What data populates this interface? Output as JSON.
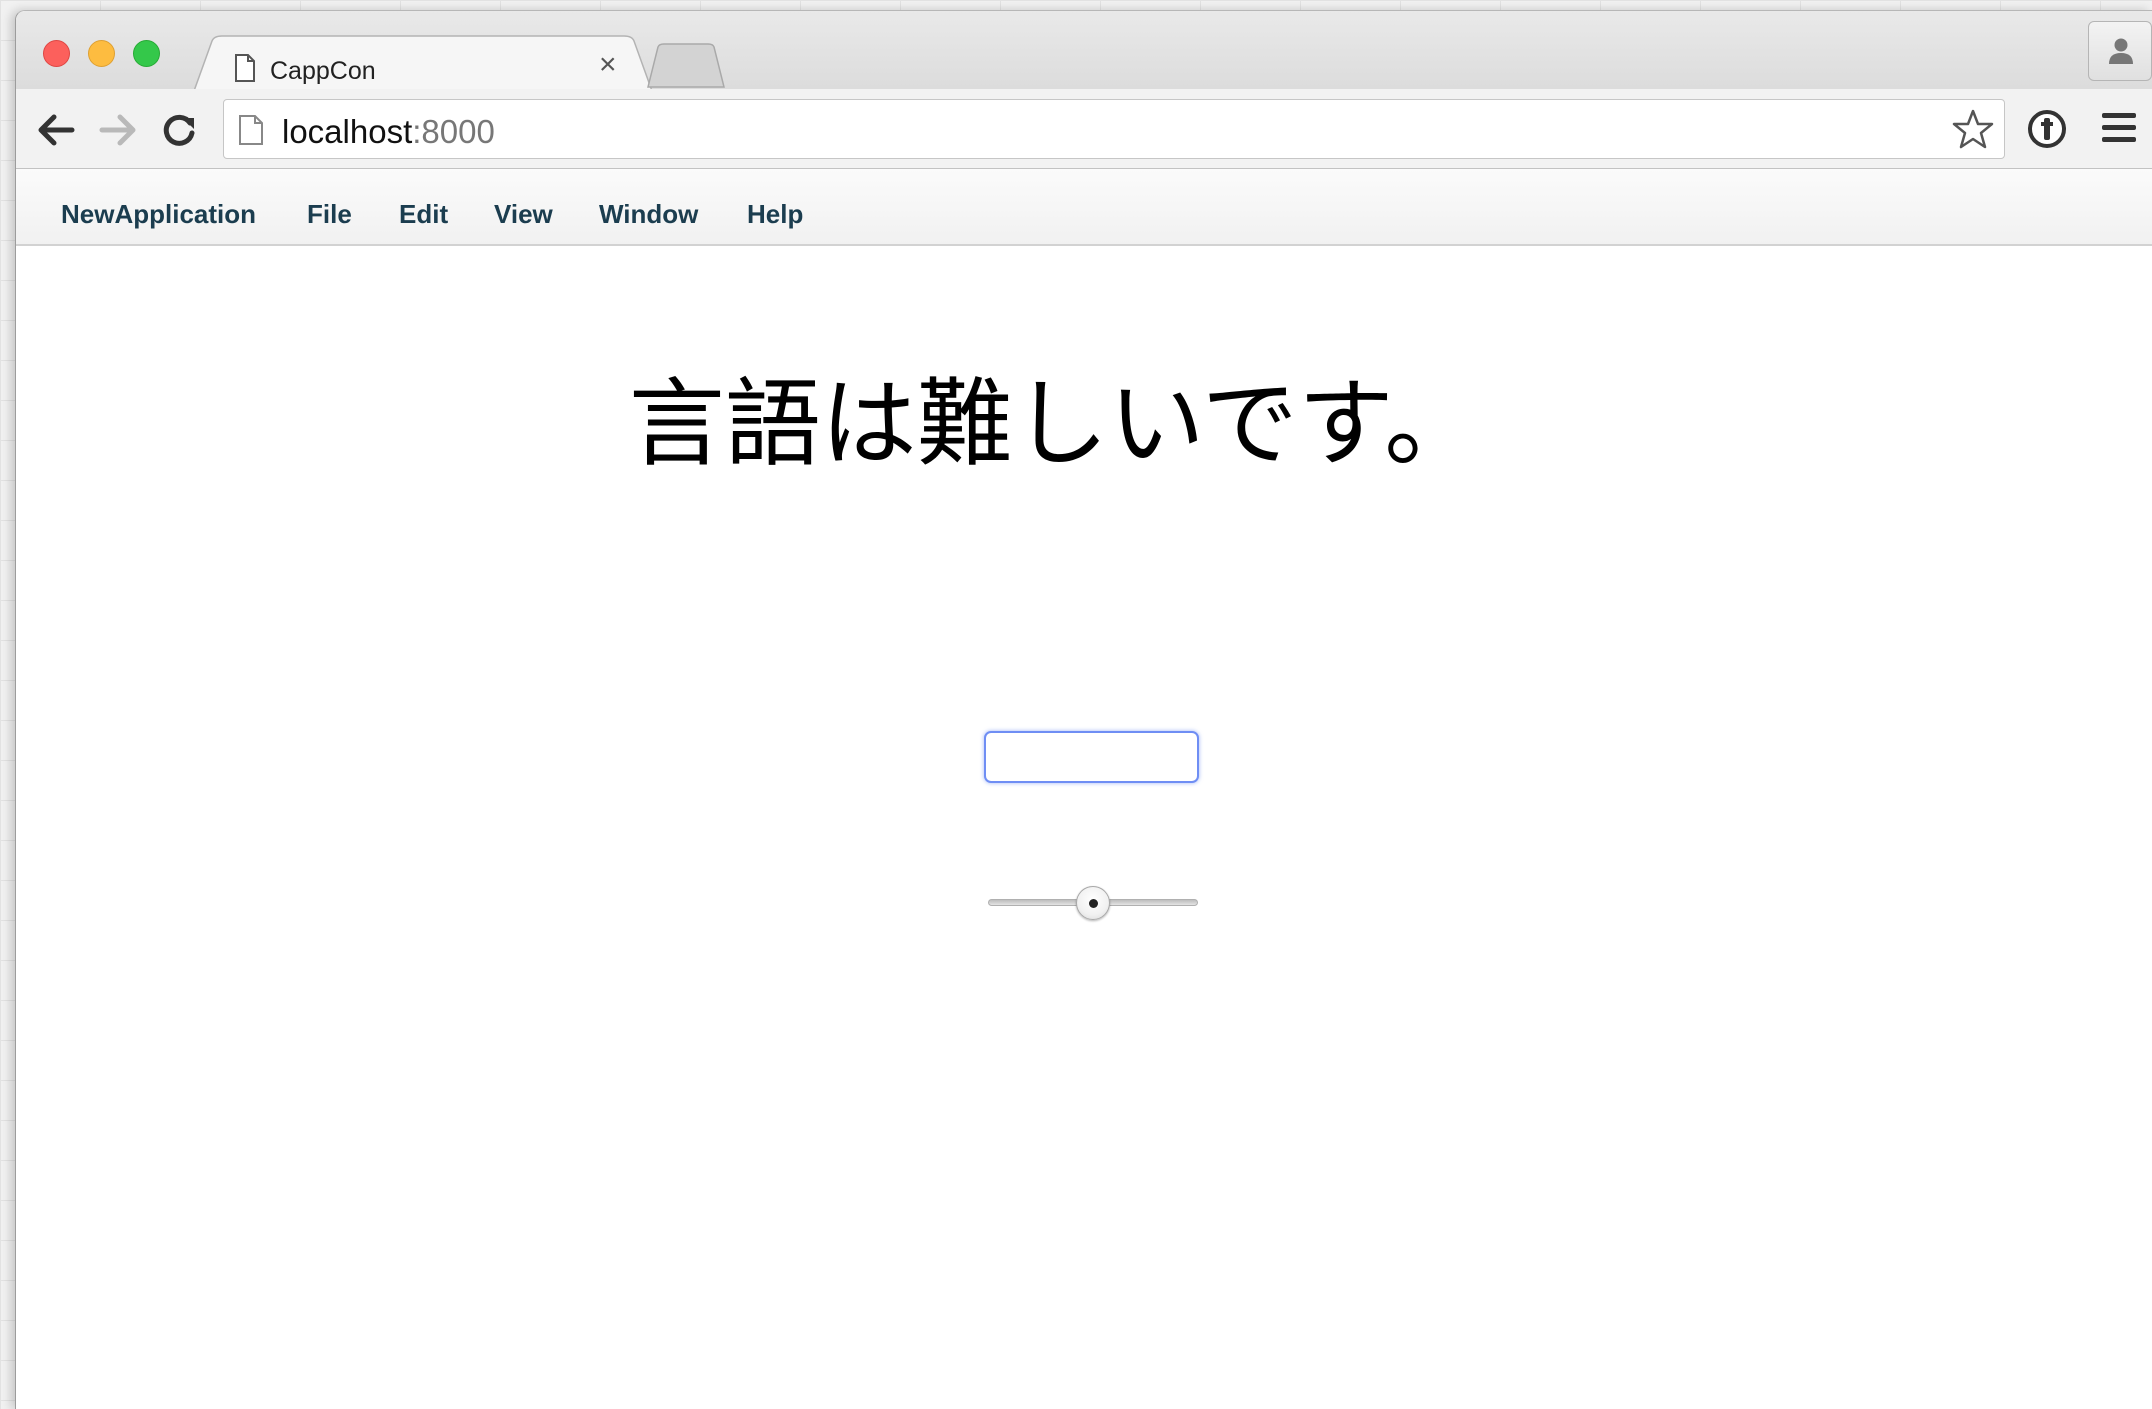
{
  "browser": {
    "tab": {
      "title": "CappCon",
      "close_glyph": "×",
      "icon": "document-icon"
    },
    "address": {
      "host": "localhost",
      "port": ":8000"
    }
  },
  "menubar": {
    "items": [
      {
        "label": "NewApplication"
      },
      {
        "label": "File"
      },
      {
        "label": "Edit"
      },
      {
        "label": "View"
      },
      {
        "label": "Window"
      },
      {
        "label": "Help"
      }
    ]
  },
  "content": {
    "heading": "言語は難しいです。",
    "text_field": {
      "value": "",
      "placeholder": ""
    },
    "slider": {
      "value": 0.5
    }
  },
  "colors": {
    "menu_text": "#1b3d4f",
    "input_focus": "#6f8ef4",
    "close": "#fc605c",
    "minimize": "#fdbc40",
    "zoom": "#34c84a"
  }
}
